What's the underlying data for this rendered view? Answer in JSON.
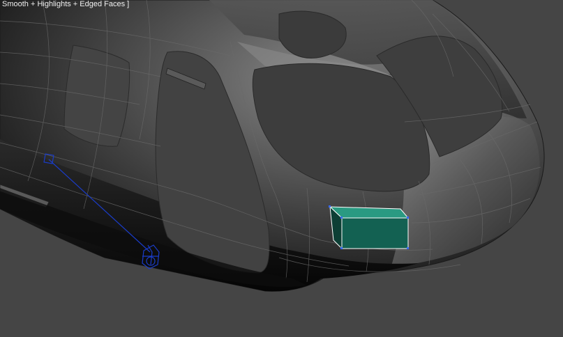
{
  "viewport": {
    "label": "Smooth + Highlights + Edged Faces ]",
    "background_color": "#454545"
  },
  "colors": {
    "selection_fill": "#136152",
    "selection_edge": "#ffffff",
    "helper_object": "#1a3cc8",
    "mesh_wire": "#5a5a5a"
  },
  "objects": [
    {
      "name": "fuselage-mesh",
      "selected": false
    },
    {
      "name": "selected-box",
      "selected": true
    },
    {
      "name": "target-helper",
      "selected": false
    }
  ]
}
